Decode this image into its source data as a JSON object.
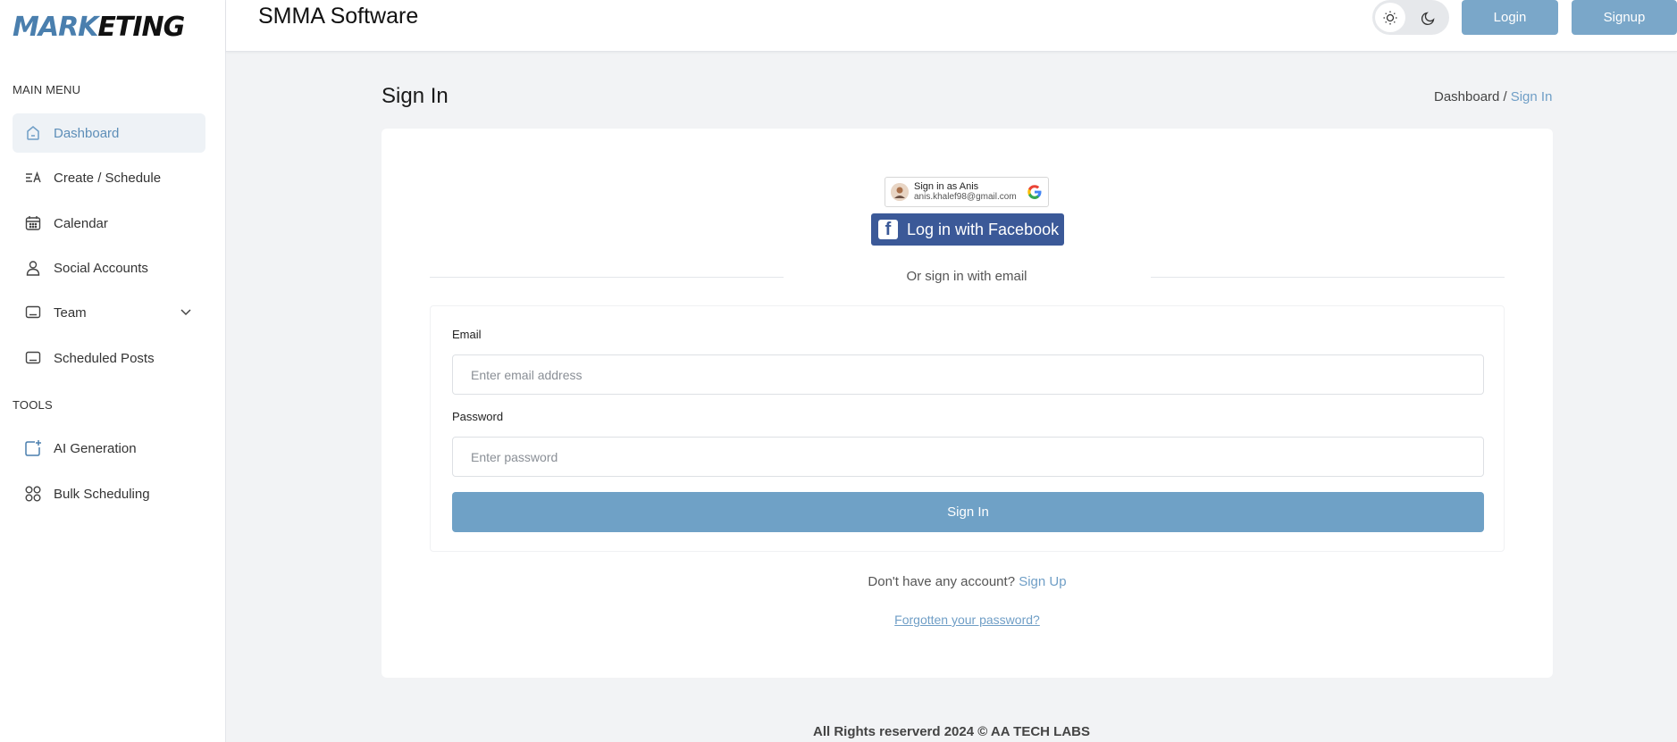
{
  "brand": {
    "logo_part1": "MARK",
    "logo_part2": "ETING"
  },
  "sidebar": {
    "main_menu_label": "MAIN MENU",
    "items": [
      {
        "label": "Dashboard",
        "icon": "home-icon",
        "active": true
      },
      {
        "label": "Create / Schedule",
        "icon": "text-format-icon"
      },
      {
        "label": "Calendar",
        "icon": "calendar-icon"
      },
      {
        "label": "Social Accounts",
        "icon": "user-icon"
      },
      {
        "label": "Team",
        "icon": "monitor-icon",
        "expandable": true
      },
      {
        "label": "Scheduled Posts",
        "icon": "monitor-icon"
      }
    ],
    "tools_label": "TOOLS",
    "tools": [
      {
        "label": "AI Generation",
        "icon": "add-image-icon"
      },
      {
        "label": "Bulk Scheduling",
        "icon": "grid-circles-icon"
      }
    ]
  },
  "header": {
    "title": "SMMA Software",
    "login_label": "Login",
    "signup_label": "Signup"
  },
  "page": {
    "title": "Sign In",
    "breadcrumb_parent": "Dashboard /",
    "breadcrumb_current": "Sign In"
  },
  "social": {
    "google_title": "Sign in as Anis",
    "google_email": "anis.khalef98@gmail.com",
    "facebook_label": "Log in with Facebook",
    "divider_text": "Or sign in with email"
  },
  "form": {
    "email_label": "Email",
    "email_placeholder": "Enter email address",
    "password_label": "Password",
    "password_placeholder": "Enter password",
    "submit_label": "Sign In"
  },
  "links": {
    "no_account_text": "Don't have any account?",
    "signup_link": "Sign Up",
    "forgot_link": "Forgotten your password?"
  },
  "footer": {
    "text": "All Rights reserverd 2024 © AA TECH LABS"
  },
  "colors": {
    "accent": "#6fa1c6",
    "facebook": "#3b5998",
    "active_bg": "#eef2f6"
  }
}
